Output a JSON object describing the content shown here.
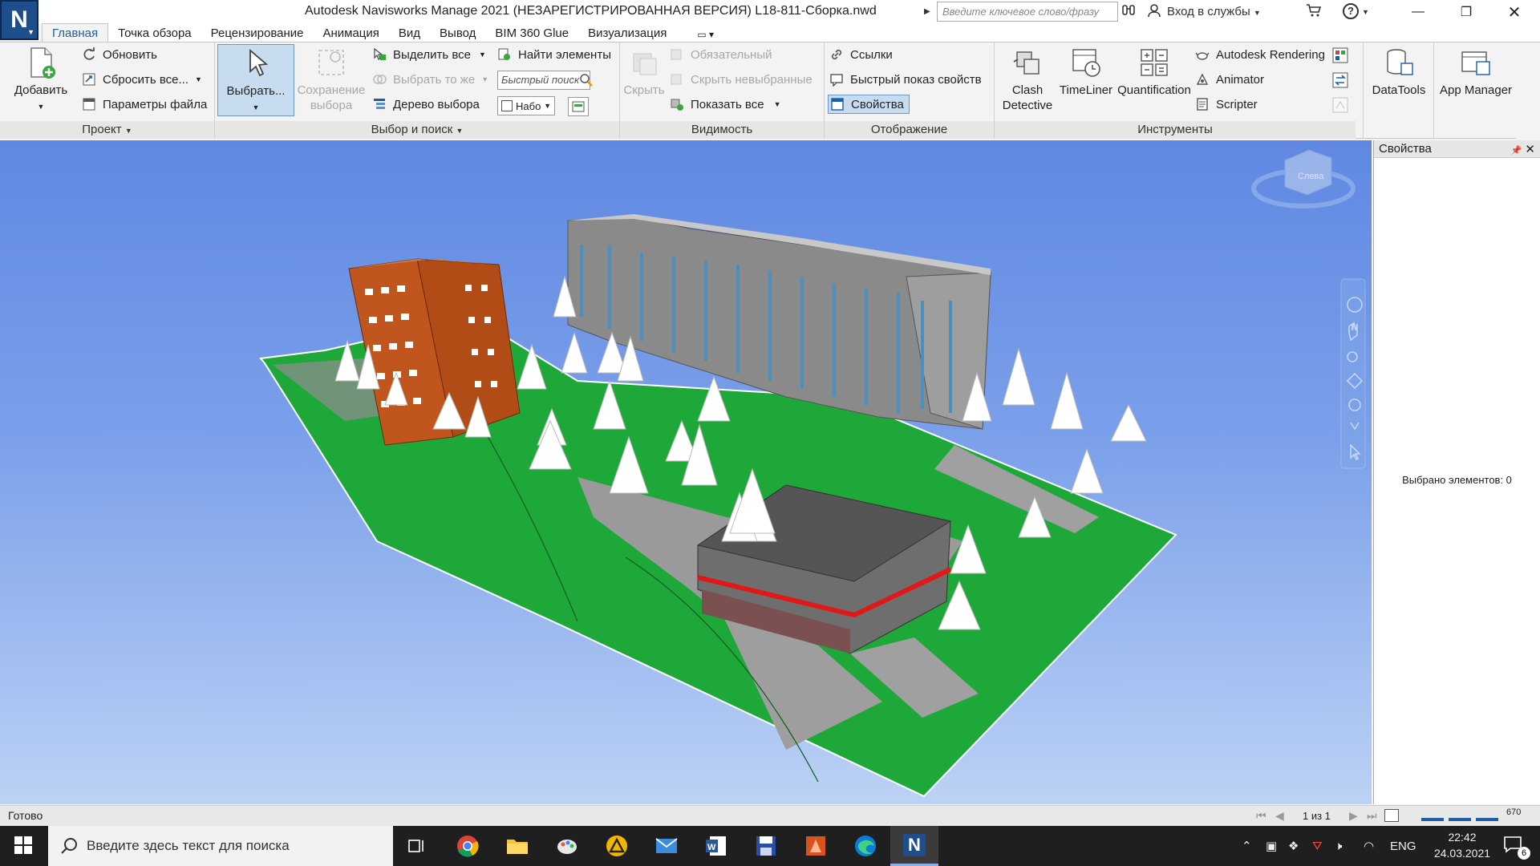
{
  "titlebar": {
    "app_logo": "N",
    "title": "Autodesk Navisworks Manage 2021 (НЕЗАРЕГИСТРИРОВАННАЯ ВЕРСИЯ)    L18-811-Сборка.nwd",
    "search_placeholder": "Введите ключевое слово/фразу",
    "login": "Вход в службы",
    "help": "?"
  },
  "tabs": [
    "Главная",
    "Точка обзора",
    "Рецензирование",
    "Анимация",
    "Вид",
    "Вывод",
    "BIM 360 Glue",
    "Визуализация"
  ],
  "ribbon": {
    "project": {
      "label": "Проект",
      "add": "Добавить",
      "refresh": "Обновить",
      "reset": "Сбросить все...",
      "file_params": "Параметры файла"
    },
    "select": {
      "label": "Выбор и поиск",
      "select_btn": "Выбрать...",
      "save_sel_1": "Сохранение",
      "save_sel_2": "выбора",
      "select_all": "Выделить все",
      "select_same": "Выбрать то же",
      "select_tree": "Дерево выбора",
      "find_items": "Найти элементы",
      "quick_search": "Быстрый поиск",
      "sets": "Набо"
    },
    "visibility": {
      "label": "Видимость",
      "hide": "Скрыть",
      "required": "Обязательный",
      "hide_unselected": "Скрыть невыбранные",
      "show_all": "Показать все"
    },
    "display": {
      "label": "Отображение",
      "links": "Ссылки",
      "quick_props": "Быстрый  показ свойств",
      "properties": "Свойства"
    },
    "tools": {
      "label": "Инструменты",
      "clash_1": "Clash",
      "clash_2": "Detective",
      "timeliner": "TimeLiner",
      "quantification": "Quantification",
      "rendering": "Autodesk Rendering",
      "animator": "Animator",
      "scripter": "Scripter",
      "datatools": "DataTools",
      "app_manager": "App Manager"
    }
  },
  "viewcube": {
    "face": "Слева"
  },
  "properties_panel": {
    "title": "Свойства",
    "selected": "Выбрано элементов: 0"
  },
  "statusbar": {
    "ready": "Готово",
    "pages": "1 из 1",
    "memory": "670"
  },
  "taskbar": {
    "search": "Введите здесь текст для поиска",
    "lang": "ENG",
    "time": "22:42",
    "date": "24.03.2021",
    "notifications": "6"
  },
  "colors": {
    "accent": "#1d5ea8",
    "grass": "#1fa83a",
    "brick": "#c0561e"
  }
}
